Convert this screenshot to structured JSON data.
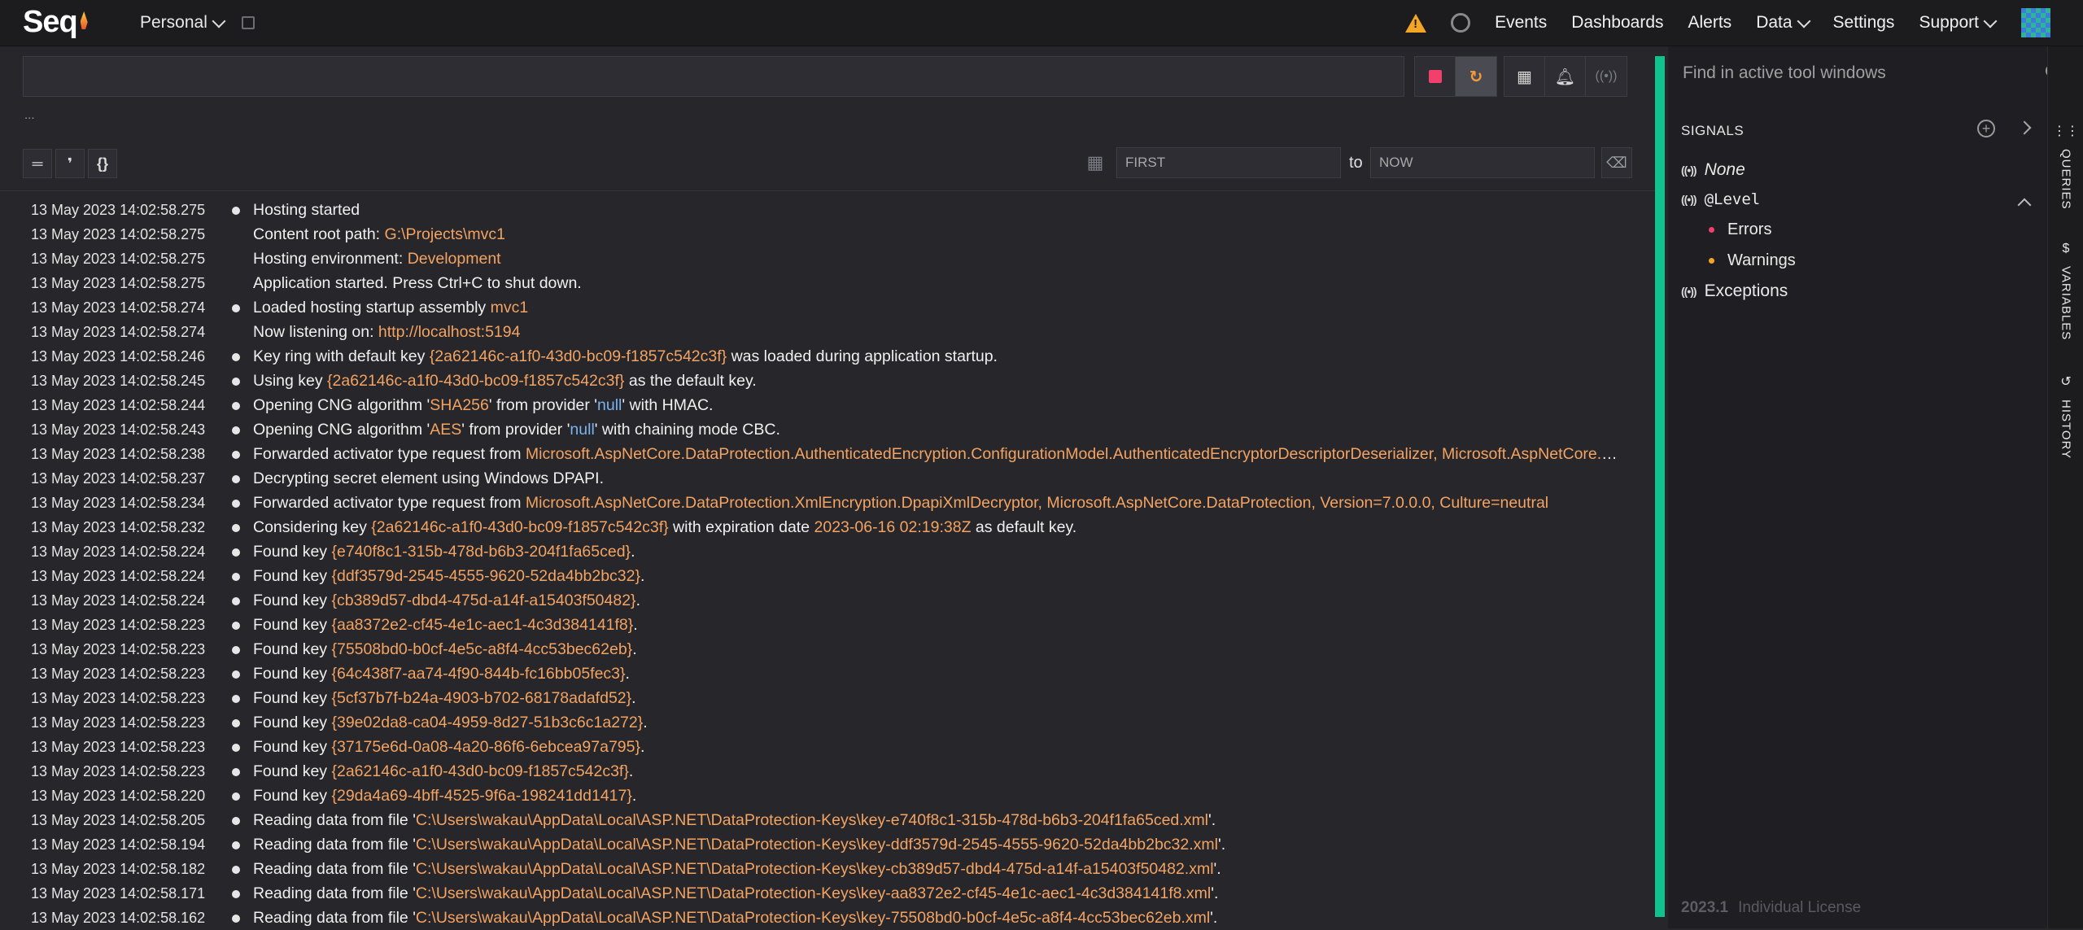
{
  "nav": {
    "logo": "Seq",
    "workspace": "Personal",
    "links": [
      "Events",
      "Dashboards",
      "Alerts",
      "Data",
      "Settings",
      "Support"
    ]
  },
  "query": {
    "value": "",
    "ellipsis": "..."
  },
  "range": {
    "from_placeholder": "FIRST",
    "to_label": "to",
    "to_placeholder": "NOW"
  },
  "view_buttons": [
    "═",
    "❜",
    "{}"
  ],
  "events": [
    {
      "ts": "13 May 2023  14:02:58.275",
      "dot": true,
      "parts": [
        [
          "Hosting started",
          ""
        ]
      ]
    },
    {
      "ts": "13 May 2023  14:02:58.275",
      "dot": false,
      "parts": [
        [
          "Content root path: ",
          ""
        ],
        [
          "G:\\Projects\\mvc1",
          "hl"
        ]
      ]
    },
    {
      "ts": "13 May 2023  14:02:58.275",
      "dot": false,
      "parts": [
        [
          "Hosting environment: ",
          ""
        ],
        [
          "Development",
          "hl"
        ]
      ]
    },
    {
      "ts": "13 May 2023  14:02:58.275",
      "dot": false,
      "parts": [
        [
          "Application started. Press Ctrl+C to shut down.",
          ""
        ]
      ]
    },
    {
      "ts": "13 May 2023  14:02:58.274",
      "dot": true,
      "parts": [
        [
          "Loaded hosting startup assembly ",
          ""
        ],
        [
          "mvc1",
          "hl"
        ]
      ]
    },
    {
      "ts": "13 May 2023  14:02:58.274",
      "dot": false,
      "parts": [
        [
          "Now listening on: ",
          ""
        ],
        [
          "http://localhost:5194",
          "hl"
        ]
      ]
    },
    {
      "ts": "13 May 2023  14:02:58.246",
      "dot": true,
      "parts": [
        [
          "Key ring with default key ",
          ""
        ],
        [
          "{2a62146c-a1f0-43d0-bc09-f1857c542c3f}",
          "hl"
        ],
        [
          " was loaded during application startup.",
          ""
        ]
      ]
    },
    {
      "ts": "13 May 2023  14:02:58.245",
      "dot": true,
      "parts": [
        [
          "Using key ",
          ""
        ],
        [
          "{2a62146c-a1f0-43d0-bc09-f1857c542c3f}",
          "hl"
        ],
        [
          " as the default key.",
          ""
        ]
      ]
    },
    {
      "ts": "13 May 2023  14:02:58.244",
      "dot": true,
      "parts": [
        [
          "Opening CNG algorithm '",
          ""
        ],
        [
          "SHA256",
          "hl"
        ],
        [
          "' from provider '",
          ""
        ],
        [
          "null",
          "hl-blue"
        ],
        [
          "' with HMAC.",
          ""
        ]
      ]
    },
    {
      "ts": "13 May 2023  14:02:58.243",
      "dot": true,
      "parts": [
        [
          "Opening CNG algorithm '",
          ""
        ],
        [
          "AES",
          "hl"
        ],
        [
          "' from provider '",
          ""
        ],
        [
          "null",
          "hl-blue"
        ],
        [
          "' with chaining mode CBC.",
          ""
        ]
      ]
    },
    {
      "ts": "13 May 2023  14:02:58.238",
      "dot": true,
      "parts": [
        [
          "Forwarded activator type request from ",
          ""
        ],
        [
          "Microsoft.AspNetCore.DataProtection.AuthenticatedEncryption.ConfigurationModel.AuthenticatedEncryptorDescriptorDeserializer, Microsoft.AspNetCore.DataProtection",
          "hl"
        ]
      ]
    },
    {
      "ts": "13 May 2023  14:02:58.237",
      "dot": true,
      "parts": [
        [
          "Decrypting secret element using Windows DPAPI.",
          ""
        ]
      ]
    },
    {
      "ts": "13 May 2023  14:02:58.234",
      "dot": true,
      "parts": [
        [
          "Forwarded activator type request from ",
          ""
        ],
        [
          "Microsoft.AspNetCore.DataProtection.XmlEncryption.DpapiXmlDecryptor, Microsoft.AspNetCore.DataProtection, Version=7.0.0.0, Culture=neutral",
          "hl"
        ]
      ]
    },
    {
      "ts": "13 May 2023  14:02:58.232",
      "dot": true,
      "parts": [
        [
          "Considering key ",
          ""
        ],
        [
          "{2a62146c-a1f0-43d0-bc09-f1857c542c3f}",
          "hl"
        ],
        [
          " with expiration date ",
          ""
        ],
        [
          "2023-06-16 02:19:38Z",
          "hl"
        ],
        [
          " as default key.",
          ""
        ]
      ]
    },
    {
      "ts": "13 May 2023  14:02:58.224",
      "dot": true,
      "parts": [
        [
          "Found key ",
          ""
        ],
        [
          "{e740f8c1-315b-478d-b6b3-204f1fa65ced}",
          "hl"
        ],
        [
          ".",
          ""
        ]
      ]
    },
    {
      "ts": "13 May 2023  14:02:58.224",
      "dot": true,
      "parts": [
        [
          "Found key ",
          ""
        ],
        [
          "{ddf3579d-2545-4555-9620-52da4bb2bc32}",
          "hl"
        ],
        [
          ".",
          ""
        ]
      ]
    },
    {
      "ts": "13 May 2023  14:02:58.224",
      "dot": true,
      "parts": [
        [
          "Found key ",
          ""
        ],
        [
          "{cb389d57-dbd4-475d-a14f-a15403f50482}",
          "hl"
        ],
        [
          ".",
          ""
        ]
      ]
    },
    {
      "ts": "13 May 2023  14:02:58.223",
      "dot": true,
      "parts": [
        [
          "Found key ",
          ""
        ],
        [
          "{aa8372e2-cf45-4e1c-aec1-4c3d384141f8}",
          "hl"
        ],
        [
          ".",
          ""
        ]
      ]
    },
    {
      "ts": "13 May 2023  14:02:58.223",
      "dot": true,
      "parts": [
        [
          "Found key ",
          ""
        ],
        [
          "{75508bd0-b0cf-4e5c-a8f4-4cc53bec62eb}",
          "hl"
        ],
        [
          ".",
          ""
        ]
      ]
    },
    {
      "ts": "13 May 2023  14:02:58.223",
      "dot": true,
      "parts": [
        [
          "Found key ",
          ""
        ],
        [
          "{64c438f7-aa74-4f90-844b-fc16bb05fec3}",
          "hl"
        ],
        [
          ".",
          ""
        ]
      ]
    },
    {
      "ts": "13 May 2023  14:02:58.223",
      "dot": true,
      "parts": [
        [
          "Found key ",
          ""
        ],
        [
          "{5cf37b7f-b24a-4903-b702-68178adafd52}",
          "hl"
        ],
        [
          ".",
          ""
        ]
      ]
    },
    {
      "ts": "13 May 2023  14:02:58.223",
      "dot": true,
      "parts": [
        [
          "Found key ",
          ""
        ],
        [
          "{39e02da8-ca04-4959-8d27-51b3c6c1a272}",
          "hl"
        ],
        [
          ".",
          ""
        ]
      ]
    },
    {
      "ts": "13 May 2023  14:02:58.223",
      "dot": true,
      "parts": [
        [
          "Found key ",
          ""
        ],
        [
          "{37175e6d-0a08-4a20-86f6-6ebcea97a795}",
          "hl"
        ],
        [
          ".",
          ""
        ]
      ]
    },
    {
      "ts": "13 May 2023  14:02:58.223",
      "dot": true,
      "parts": [
        [
          "Found key ",
          ""
        ],
        [
          "{2a62146c-a1f0-43d0-bc09-f1857c542c3f}",
          "hl"
        ],
        [
          ".",
          ""
        ]
      ]
    },
    {
      "ts": "13 May 2023  14:02:58.220",
      "dot": true,
      "parts": [
        [
          "Found key ",
          ""
        ],
        [
          "{29da4a69-4bff-4525-9f6a-198241dd1417}",
          "hl"
        ],
        [
          ".",
          ""
        ]
      ]
    },
    {
      "ts": "13 May 2023  14:02:58.205",
      "dot": true,
      "parts": [
        [
          "Reading data from file '",
          ""
        ],
        [
          "C:\\Users\\wakau\\AppData\\Local\\ASP.NET\\DataProtection-Keys\\key-e740f8c1-315b-478d-b6b3-204f1fa65ced.xml",
          "hl"
        ],
        [
          "'.",
          ""
        ]
      ]
    },
    {
      "ts": "13 May 2023  14:02:58.194",
      "dot": true,
      "parts": [
        [
          "Reading data from file '",
          ""
        ],
        [
          "C:\\Users\\wakau\\AppData\\Local\\ASP.NET\\DataProtection-Keys\\key-ddf3579d-2545-4555-9620-52da4bb2bc32.xml",
          "hl"
        ],
        [
          "'.",
          ""
        ]
      ]
    },
    {
      "ts": "13 May 2023  14:02:58.182",
      "dot": true,
      "parts": [
        [
          "Reading data from file '",
          ""
        ],
        [
          "C:\\Users\\wakau\\AppData\\Local\\ASP.NET\\DataProtection-Keys\\key-cb389d57-dbd4-475d-a14f-a15403f50482.xml",
          "hl"
        ],
        [
          "'.",
          ""
        ]
      ]
    },
    {
      "ts": "13 May 2023  14:02:58.171",
      "dot": true,
      "parts": [
        [
          "Reading data from file '",
          ""
        ],
        [
          "C:\\Users\\wakau\\AppData\\Local\\ASP.NET\\DataProtection-Keys\\key-aa8372e2-cf45-4e1c-aec1-4c3d384141f8.xml",
          "hl"
        ],
        [
          "'.",
          ""
        ]
      ]
    },
    {
      "ts": "13 May 2023  14:02:58.162",
      "dot": true,
      "parts": [
        [
          "Reading data from file '",
          ""
        ],
        [
          "C:\\Users\\wakau\\AppData\\Local\\ASP.NET\\DataProtection-Keys\\key-75508bd0-b0cf-4e5c-a8f4-4cc53bec62eb.xml",
          "hl"
        ],
        [
          "'.",
          ""
        ]
      ]
    }
  ],
  "side": {
    "find_placeholder": "Find in active tool windows",
    "signals_title": "SIGNALS",
    "signals": {
      "none": "None",
      "level": "@Level",
      "errors": "Errors",
      "warnings": "Warnings",
      "exceptions": "Exceptions"
    },
    "colors": {
      "errors": "#f0406b",
      "warnings": "#f2a623",
      "accent": "#12c28e"
    },
    "version": "2023.1",
    "license": "Individual License"
  },
  "vtabs": {
    "queries": "QUERIES",
    "variables": "VARIABLES",
    "history": "HISTORY"
  }
}
